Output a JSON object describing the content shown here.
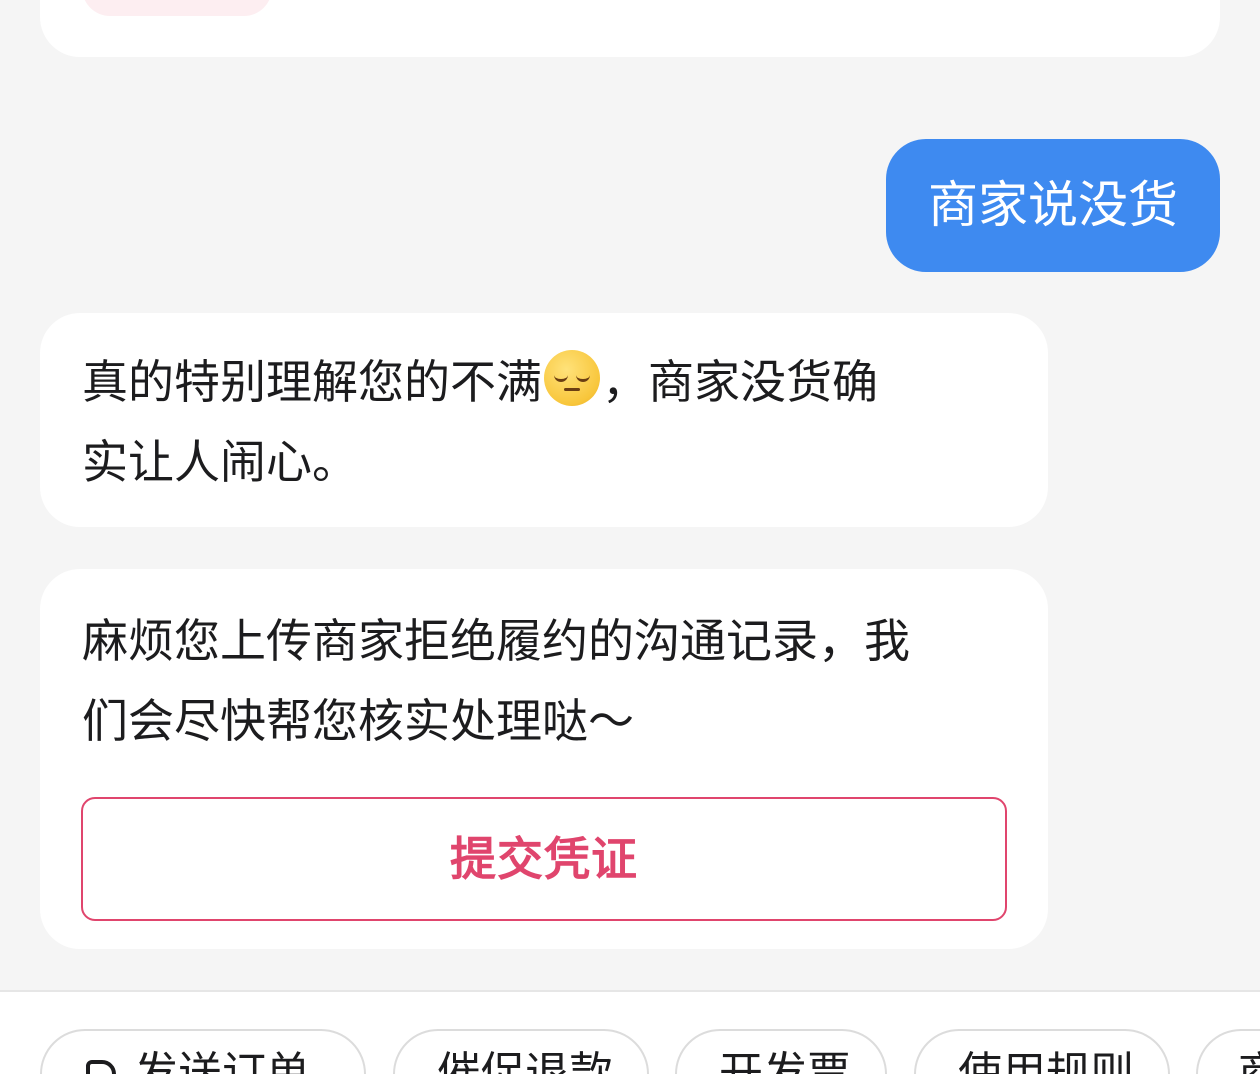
{
  "chat": {
    "user_message": "商家说没货",
    "bot_message_1": {
      "line1_before_emoji": "真的特别理解您的不满",
      "emoji": "😔",
      "line1_after_emoji": "，商家没货确",
      "line2": "实让人闹心。"
    },
    "bot_message_2": {
      "line1": "麻烦您上传商家拒绝履约的沟通记录，我",
      "line2": "们会尽快帮您核实处理哒～",
      "button_label": "提交凭证"
    }
  },
  "quick_actions": [
    {
      "label": "发送订单",
      "icon": "document-icon"
    },
    {
      "label": "催促退款"
    },
    {
      "label": "开发票"
    },
    {
      "label": "使用规则"
    },
    {
      "label": "商"
    }
  ],
  "colors": {
    "user_bubble": "#3e8af0",
    "accent": "#e0456d",
    "background": "#f5f5f5"
  }
}
